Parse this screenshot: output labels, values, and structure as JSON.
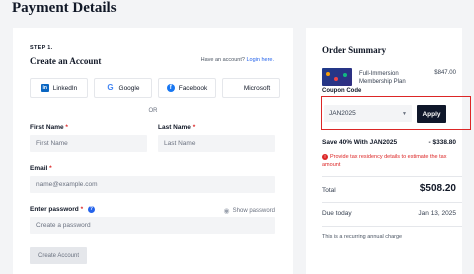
{
  "page": {
    "title": "Payment Details"
  },
  "account": {
    "step": "STEP 1.",
    "title": "Create an Account",
    "login_prompt": "Have an account?",
    "login_link": "Login here.",
    "social": [
      {
        "label": "LinkedIn",
        "icon": "linkedin-icon"
      },
      {
        "label": "Google",
        "icon": "google-icon"
      },
      {
        "label": "Facebook",
        "icon": "facebook-icon"
      },
      {
        "label": "Microsoft",
        "icon": "microsoft-icon"
      }
    ],
    "or": "OR",
    "first_name": {
      "label": "First Name",
      "required": "*",
      "placeholder": "First Name"
    },
    "last_name": {
      "label": "Last Name",
      "required": "*",
      "placeholder": "Last Name"
    },
    "email": {
      "label": "Email",
      "required": "*",
      "placeholder": "name@example.com"
    },
    "password": {
      "label": "Enter password",
      "required": "*",
      "placeholder": "Create a password",
      "show_label": "Show password"
    },
    "create_button": "Create Account"
  },
  "summary": {
    "title": "Order Summary",
    "product": {
      "name": "Full-Immersion Membership Plan",
      "price": "$847.00"
    },
    "coupon_label": "Coupon Code",
    "coupon_value": "JAN2025",
    "apply_label": "Apply",
    "savings_label": "Save 40% With JAN2025",
    "savings_amount": "- $338.80",
    "tax_notice": "Provide tax residency details to estimate the tax amount",
    "total_label": "Total",
    "total_amount": "$508.20",
    "due_label": "Due today",
    "due_date": "Jan 13, 2025",
    "recurring_note": "This is a recurring annual charge"
  },
  "colors": {
    "accent": "#2563eb",
    "error": "#dc2626",
    "primary_button": "#0f172a"
  }
}
